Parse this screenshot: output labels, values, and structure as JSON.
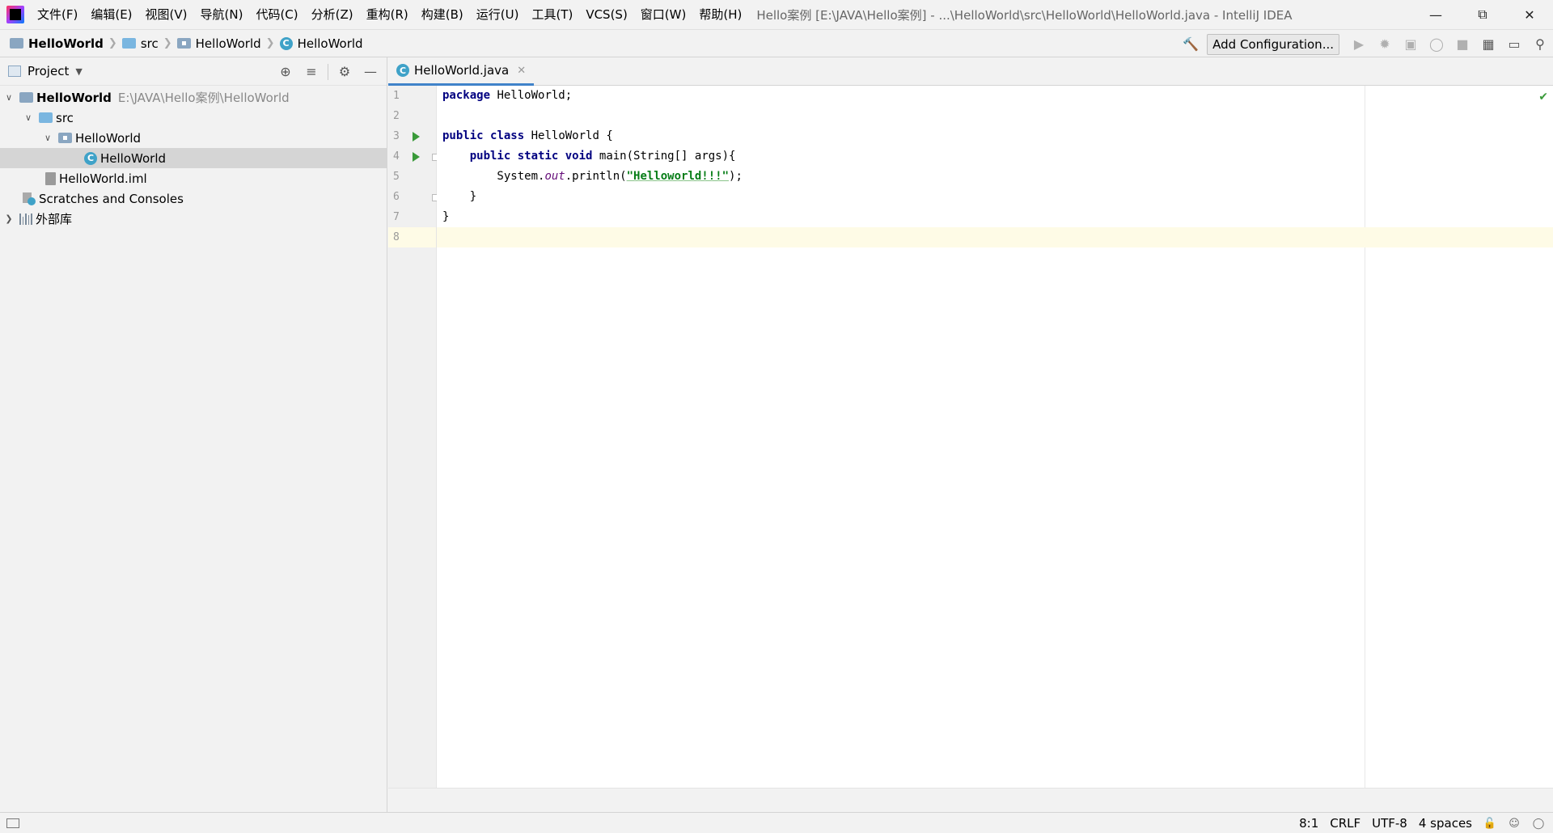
{
  "menu": [
    "文件(F)",
    "编辑(E)",
    "视图(V)",
    "导航(N)",
    "代码(C)",
    "分析(Z)",
    "重构(R)",
    "构建(B)",
    "运行(U)",
    "工具(T)",
    "VCS(S)",
    "窗口(W)",
    "帮助(H)"
  ],
  "window_title": "Hello案例 [E:\\JAVA\\Hello案例] - ...\\HelloWorld\\src\\HelloWorld\\HelloWorld.java - IntelliJ IDEA",
  "breadcrumb": [
    "HelloWorld",
    "src",
    "HelloWorld",
    "HelloWorld"
  ],
  "toolbar": {
    "add_configuration": "Add Configuration..."
  },
  "project_panel": {
    "title": "Project",
    "tree": [
      {
        "label": "HelloWorld",
        "hint": "E:\\JAVA\\Hello案例\\HelloWorld"
      },
      {
        "label": "src"
      },
      {
        "label": "HelloWorld"
      },
      {
        "label": "HelloWorld"
      },
      {
        "label": "HelloWorld.iml"
      },
      {
        "label": "Scratches and Consoles"
      },
      {
        "label": "外部库"
      }
    ]
  },
  "editor": {
    "tab_label": "HelloWorld.java",
    "line_numbers": [
      "1",
      "2",
      "3",
      "4",
      "5",
      "6",
      "7",
      "8"
    ],
    "code": {
      "l1_kw": "package",
      "l1_rest": " HelloWorld;",
      "l3_kw1": "public",
      "l3_kw2": "class",
      "l3_rest": " HelloWorld {",
      "l4_indent": "    ",
      "l4_kw1": "public",
      "l4_kw2": "static",
      "l4_kw3": "void",
      "l4_rest": " main(String[] args){",
      "l5_pre": "        System.",
      "l5_field": "out",
      "l5_mid": ".println(",
      "l5_str": "\"Helloworld!!!\"",
      "l5_post": ");",
      "l6": "    }",
      "l7": "}"
    }
  },
  "status": {
    "position": "8:1",
    "line_separator": "CRLF",
    "encoding": "UTF-8",
    "indent": "4 spaces"
  }
}
